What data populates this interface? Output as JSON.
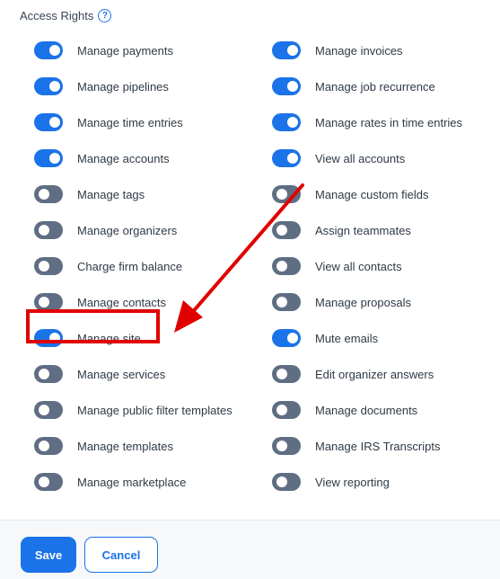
{
  "section": {
    "title": "Access Rights",
    "help_icon": "question-circle-icon"
  },
  "colors": {
    "accent": "#1a73e8",
    "toggle_off": "#5f6e82",
    "annotation": "#e00000"
  },
  "permissions_left": [
    {
      "label": "Manage payments",
      "enabled": true
    },
    {
      "label": "Manage pipelines",
      "enabled": true
    },
    {
      "label": "Manage time entries",
      "enabled": true
    },
    {
      "label": "Manage accounts",
      "enabled": true
    },
    {
      "label": "Manage tags",
      "enabled": false
    },
    {
      "label": "Manage organizers",
      "enabled": false
    },
    {
      "label": "Charge firm balance",
      "enabled": false
    },
    {
      "label": "Manage contacts",
      "enabled": false
    },
    {
      "label": "Manage site",
      "enabled": true
    },
    {
      "label": "Manage services",
      "enabled": false
    },
    {
      "label": "Manage public filter templates",
      "enabled": false
    },
    {
      "label": "Manage templates",
      "enabled": false
    },
    {
      "label": "Manage marketplace",
      "enabled": false
    }
  ],
  "permissions_right": [
    {
      "label": "Manage invoices",
      "enabled": true
    },
    {
      "label": "Manage job recurrence",
      "enabled": true
    },
    {
      "label": "Manage rates in time entries",
      "enabled": true
    },
    {
      "label": "View all accounts",
      "enabled": true
    },
    {
      "label": "Manage custom fields",
      "enabled": false
    },
    {
      "label": "Assign teammates",
      "enabled": false
    },
    {
      "label": "View all contacts",
      "enabled": false
    },
    {
      "label": "Manage proposals",
      "enabled": false
    },
    {
      "label": "Mute emails",
      "enabled": true
    },
    {
      "label": "Edit organizer answers",
      "enabled": false
    },
    {
      "label": "Manage documents",
      "enabled": false
    },
    {
      "label": "Manage IRS Transcripts",
      "enabled": false
    },
    {
      "label": "View reporting",
      "enabled": false
    }
  ],
  "footer": {
    "save_label": "Save",
    "cancel_label": "Cancel"
  }
}
